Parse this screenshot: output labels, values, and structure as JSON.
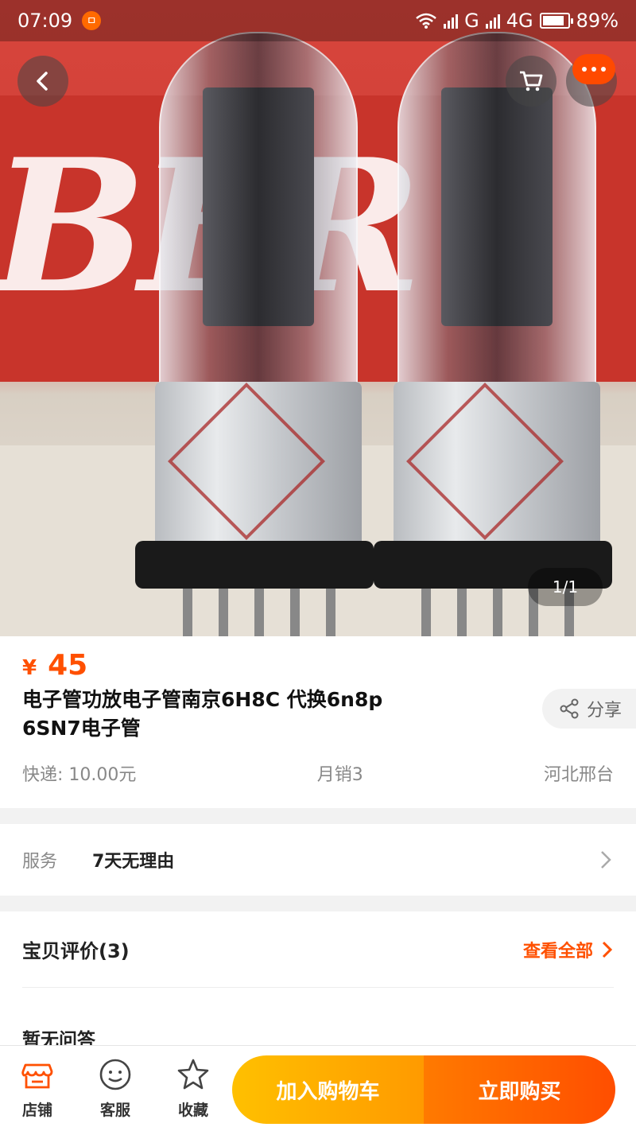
{
  "status_bar": {
    "time": "07:09",
    "notif_glyph": "ㅁ",
    "network_1": "G",
    "network_2": "4G",
    "battery": "89%",
    "battery_level": 0.89
  },
  "hero": {
    "pager": "1/1",
    "back_icon": "chevron-left-icon",
    "cart_icon": "cart-icon",
    "more_icon": "more-dots-icon",
    "brand_text": "BER"
  },
  "product": {
    "currency": "¥",
    "price": "45",
    "title": "电子管功放电子管南京6H8C 代换6n8p 6SN7电子管",
    "share_label": "分享",
    "shipping": "快递: 10.00元",
    "monthly_sales": "月销3",
    "location": "河北邢台"
  },
  "service": {
    "label": "服务",
    "value": "7天无理由"
  },
  "reviews": {
    "title": "宝贝评价(3)",
    "view_all": "查看全部",
    "qa": "暂无问答"
  },
  "bottom_bar": {
    "shop": "店铺",
    "support": "客服",
    "favorite": "收藏",
    "add_to_cart": "加入购物车",
    "buy_now": "立即购买"
  },
  "colors": {
    "accent": "#ff5000",
    "cart_btn": "#ffb000",
    "buy_btn": "#ff6000"
  }
}
